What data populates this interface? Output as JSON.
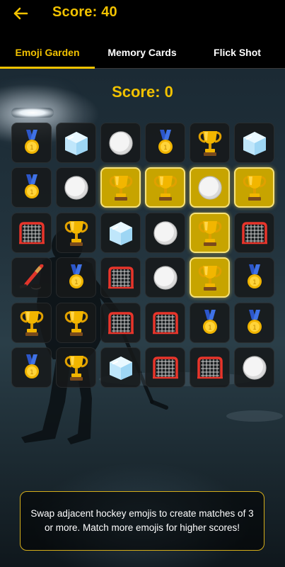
{
  "header": {
    "back_icon": "arrow-left-icon",
    "score_text": "Score: 40"
  },
  "tabs": [
    {
      "label": "Emoji Garden",
      "active": true
    },
    {
      "label": "Memory Cards",
      "active": false
    },
    {
      "label": "Flick Shot",
      "active": false
    }
  ],
  "game": {
    "score_text": "Score: 0",
    "grid": [
      [
        "medal",
        "ice",
        "puck",
        "medal",
        "trophy",
        "ice"
      ],
      [
        "medal",
        "puck",
        "trophy",
        "trophy",
        "puck",
        "trophy"
      ],
      [
        "net",
        "trophy",
        "ice",
        "puck",
        "trophy",
        "net"
      ],
      [
        "stick",
        "medal",
        "net",
        "puck",
        "trophy",
        "medal"
      ],
      [
        "trophy",
        "trophy",
        "net",
        "net",
        "medal",
        "medal"
      ],
      [
        "medal",
        "trophy",
        "ice",
        "net",
        "net",
        "puck"
      ]
    ],
    "matched": [
      [
        false,
        false,
        false,
        false,
        false,
        false
      ],
      [
        false,
        false,
        true,
        true,
        true,
        true
      ],
      [
        false,
        false,
        false,
        false,
        true,
        false
      ],
      [
        false,
        false,
        false,
        false,
        true,
        false
      ],
      [
        false,
        false,
        false,
        false,
        false,
        false
      ],
      [
        false,
        false,
        false,
        false,
        false,
        false
      ]
    ],
    "hint": "Swap adjacent hockey emojis to create matches of 3 or more. Match more emojis for higher scores!"
  },
  "colors": {
    "accent": "#f2c200",
    "matched_tile": "#c7a400",
    "tile": "#16181a"
  }
}
